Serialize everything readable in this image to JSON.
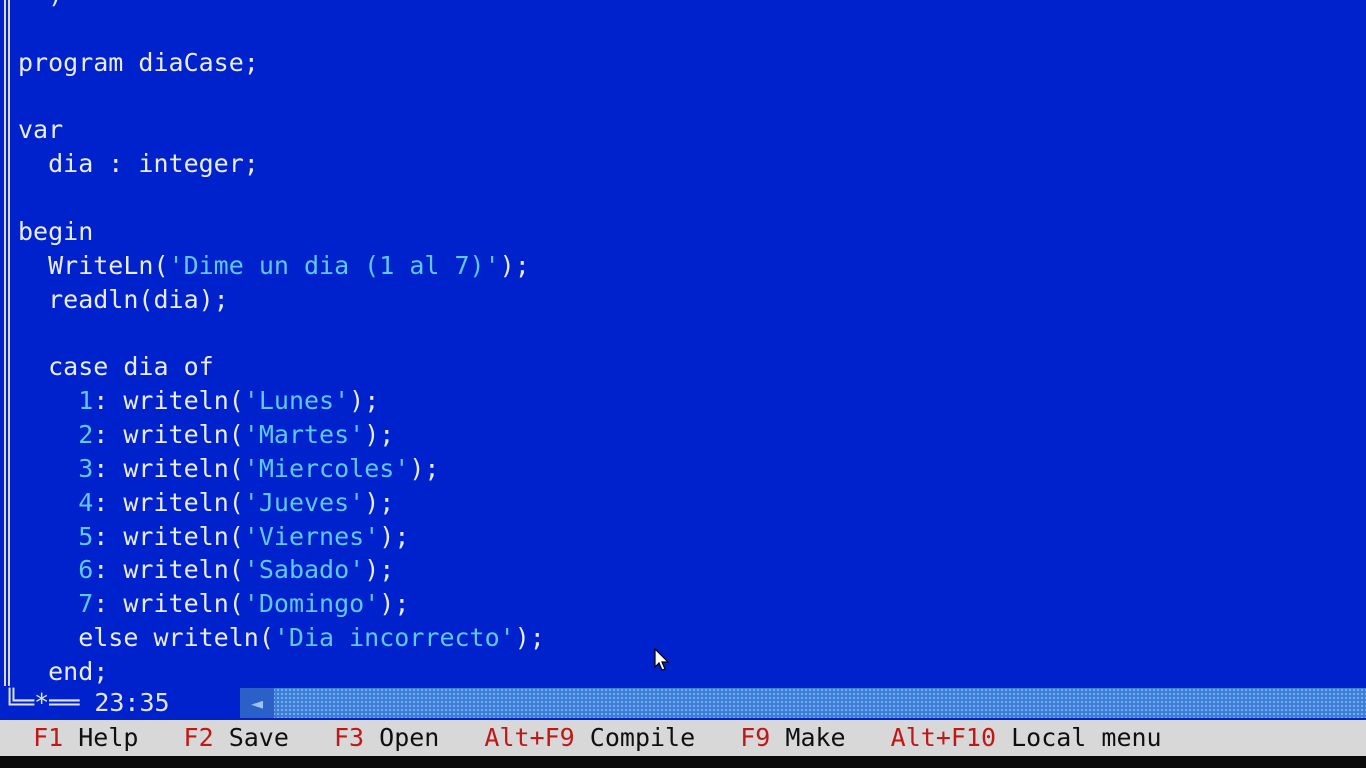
{
  "editor": {
    "lines": [
      "  )",
      "",
      "program diaCase;",
      "",
      "var",
      "  dia : integer;",
      "",
      "begin",
      "  WriteLn('Dime un dia (1 al 7)');",
      "  readln(dia);",
      "",
      "  case dia of",
      "    1: writeln('Lunes');",
      "    2: writeln('Martes');",
      "    3: writeln('Miercoles');",
      "    4: writeln('Jueves');",
      "    5: writeln('Viernes');",
      "    6: writeln('Sabado');",
      "    7: writeln('Domingo');",
      "    else writeln('Dia incorrecto');",
      "  end;"
    ]
  },
  "status": {
    "modified_marker": "*",
    "cursor_position": "23:35",
    "scroll_left_arrow": "◄"
  },
  "function_keys": [
    {
      "key": "F1",
      "label": "Help"
    },
    {
      "key": "F2",
      "label": "Save"
    },
    {
      "key": "F3",
      "label": "Open"
    },
    {
      "key": "Alt+F9",
      "label": "Compile"
    },
    {
      "key": "F9",
      "label": "Make"
    },
    {
      "key": "Alt+F10",
      "label": "Local menu"
    }
  ],
  "colors": {
    "editor_background": "#0022cc",
    "code_text": "#e8ecf4",
    "string_literal": "#5fc8f0",
    "function_bar": "#d8d8d8",
    "hotkey": "#c01818"
  }
}
